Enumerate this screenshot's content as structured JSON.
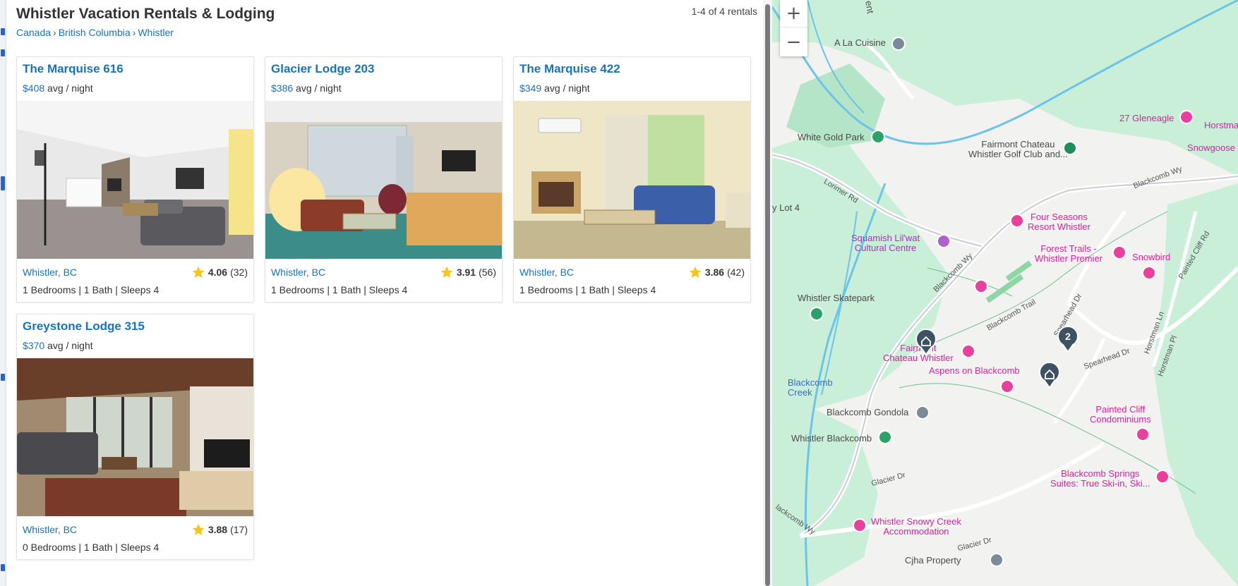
{
  "header": {
    "title": "Whistler Vacation Rentals & Lodging",
    "result_count": "1-4 of 4 rentals"
  },
  "breadcrumb": [
    "Canada",
    "British Columbia",
    "Whistler"
  ],
  "breadcrumb_sep": "›",
  "listings": [
    {
      "name": "The Marquise 616",
      "price": "$408",
      "price_suffix": "avg / night",
      "location": "Whistler, BC",
      "rating": "4.06",
      "reviews": "(32)",
      "details": "1 Bedrooms | 1 Bath | Sleeps 4"
    },
    {
      "name": "Glacier Lodge 203",
      "price": "$386",
      "price_suffix": "avg / night",
      "location": "Whistler, BC",
      "rating": "3.91",
      "reviews": "(56)",
      "details": "1 Bedrooms | 1 Bath | Sleeps 4"
    },
    {
      "name": "The Marquise 422",
      "price": "$349",
      "price_suffix": "avg / night",
      "location": "Whistler, BC",
      "rating": "3.86",
      "reviews": "(42)",
      "details": "1 Bedrooms | 1 Bath | Sleeps 4"
    },
    {
      "name": "Greystone Lodge 315",
      "price": "$370",
      "price_suffix": "avg / night",
      "location": "Whistler, BC",
      "rating": "3.88",
      "reviews": "(17)",
      "details": "0 Bedrooms | 1 Bath | Sleeps 4"
    }
  ],
  "map": {
    "zoom_in": "+",
    "zoom_out": "−",
    "cluster_count": "2",
    "labels": {
      "a_la_cuisine": "A La Cuisine",
      "white_gold_park": "White Gold Park",
      "fairmont_golf": "Fairmont Chateau\nWhistler Golf Club and...",
      "gleneagle": "27 Gleneagle",
      "horstman": "Horstma",
      "snowgoose": "Snowgoose",
      "lot4": "y Lot 4",
      "lorimer": "Lorimer Rd",
      "blackcomb_wy_top": "Blackcomb Wy",
      "four_seasons": "Four Seasons\nResort Whistler",
      "forest_trails": "Forest Trails -\nWhistler Premier",
      "snowbird": "Snowbird",
      "painted_cliff_rd": "Painted Cliff Rd",
      "squamish": "Squamish Lil'wat\nCultural Centre",
      "blackcomb_wy_mid": "Blackcomb Wy",
      "blackcomb_trail": "Blackcomb Trail",
      "spearhead_dr": "Spearhead Dr",
      "spearhead_dr2": "Spearhead Dr",
      "horstman_ln": "Horstman Ln",
      "horstman_pl": "Horstman Pl",
      "skatepark": "Whistler Skatepark",
      "fairmont_chateau": "Fairmont\nChateau Whistler",
      "aspens": "Aspens on Blackcomb",
      "blackcomb_creek": "Blackcomb\nCreek",
      "gondola": "Blackcomb Gondola",
      "whistler_blackcomb": "Whistler Blackcomb",
      "painted_cliff_condos": "Painted Cliff\nCondominiums",
      "blackcomb_springs": "Blackcomb Springs\nSuites: True Ski-in, Ski...",
      "glacier_dr": "Glacier Dr",
      "blackcomb_wy_bottom": "lackcomb Wy",
      "snowy_creek": "Whistler Snowy Creek\nAccommodation",
      "glacier_dr2": "Glacier Dr",
      "cjha": "Cjha Property",
      "ent": "ent"
    }
  },
  "colors": {
    "link": "#1a73b8",
    "star": "#f5c518",
    "map_green": "#c9efd9",
    "water": "#6cc4e8",
    "marker": "#3d5363",
    "pink_poi": "#e8409c"
  }
}
